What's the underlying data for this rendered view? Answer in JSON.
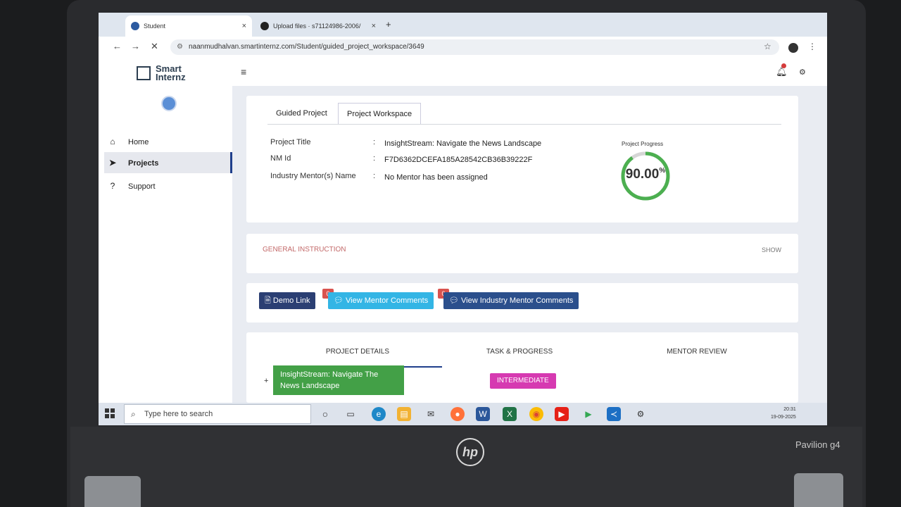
{
  "device": {
    "brand_logo_text": "hp",
    "model": "Pavilion g4"
  },
  "browser": {
    "tabs": [
      {
        "title": "Student",
        "active": true
      },
      {
        "title": "Upload files · s71124986-2006/",
        "active": false
      }
    ],
    "new_tab_symbol": "+",
    "close_symbol": "×",
    "url": "naanmudhalvan.smartinternz.com/Student/guided_project_workspace/3649",
    "nav": {
      "back": "←",
      "forward": "→",
      "stop": "✕"
    }
  },
  "app": {
    "brand_line1": "Smart",
    "brand_line2": "Internz",
    "hamburger": "≡",
    "sidebar": [
      {
        "label": "Home",
        "icon": "home-icon",
        "glyph": "⌂",
        "active": false
      },
      {
        "label": "Projects",
        "icon": "paper-plane-icon",
        "glyph": "➤",
        "active": true
      },
      {
        "label": "Support",
        "icon": "question-icon",
        "glyph": "?",
        "active": false
      }
    ]
  },
  "workspace": {
    "tabs": [
      "Guided Project",
      "Project Workspace"
    ],
    "active_tab": "Project Workspace",
    "fields": [
      {
        "label": "Project Title",
        "value": "InsightStream: Navigate the News Landscape"
      },
      {
        "label": "NM Id",
        "value": "F7D6362DCEFA185A28542CB36B39222F"
      },
      {
        "label": "Industry Mentor(s) Name",
        "value": "No Mentor has been assigned"
      }
    ],
    "colon": ":",
    "progress_label": "Project Progress",
    "progress_value": "90.00",
    "progress_unit": "%",
    "progress_fraction": 0.9
  },
  "general_instruction": {
    "title": "GENERAL INSTRUCTION",
    "toggle": "SHOW"
  },
  "actions": {
    "demo_link": "Demo Link",
    "mentor_comments": "View Mentor Comments",
    "mentor_comments_count": "0",
    "industry_comments": "View Industry Mentor Comments",
    "industry_comments_count": "0"
  },
  "details": {
    "tabs": [
      "PROJECT DETAILS",
      "TASK & PROGRESS",
      "MENTOR REVIEW"
    ],
    "project_name": "InsightStream: Navigate The News Landscape",
    "level": "INTERMEDIATE",
    "expand": "+"
  },
  "taskbar": {
    "search_placeholder": "Type here to search",
    "time": "20:31",
    "date": "19-09-2025"
  },
  "colors": {
    "accent": "#1f3f8c",
    "progress_green": "#4caf50",
    "badge": "#d9534f"
  }
}
